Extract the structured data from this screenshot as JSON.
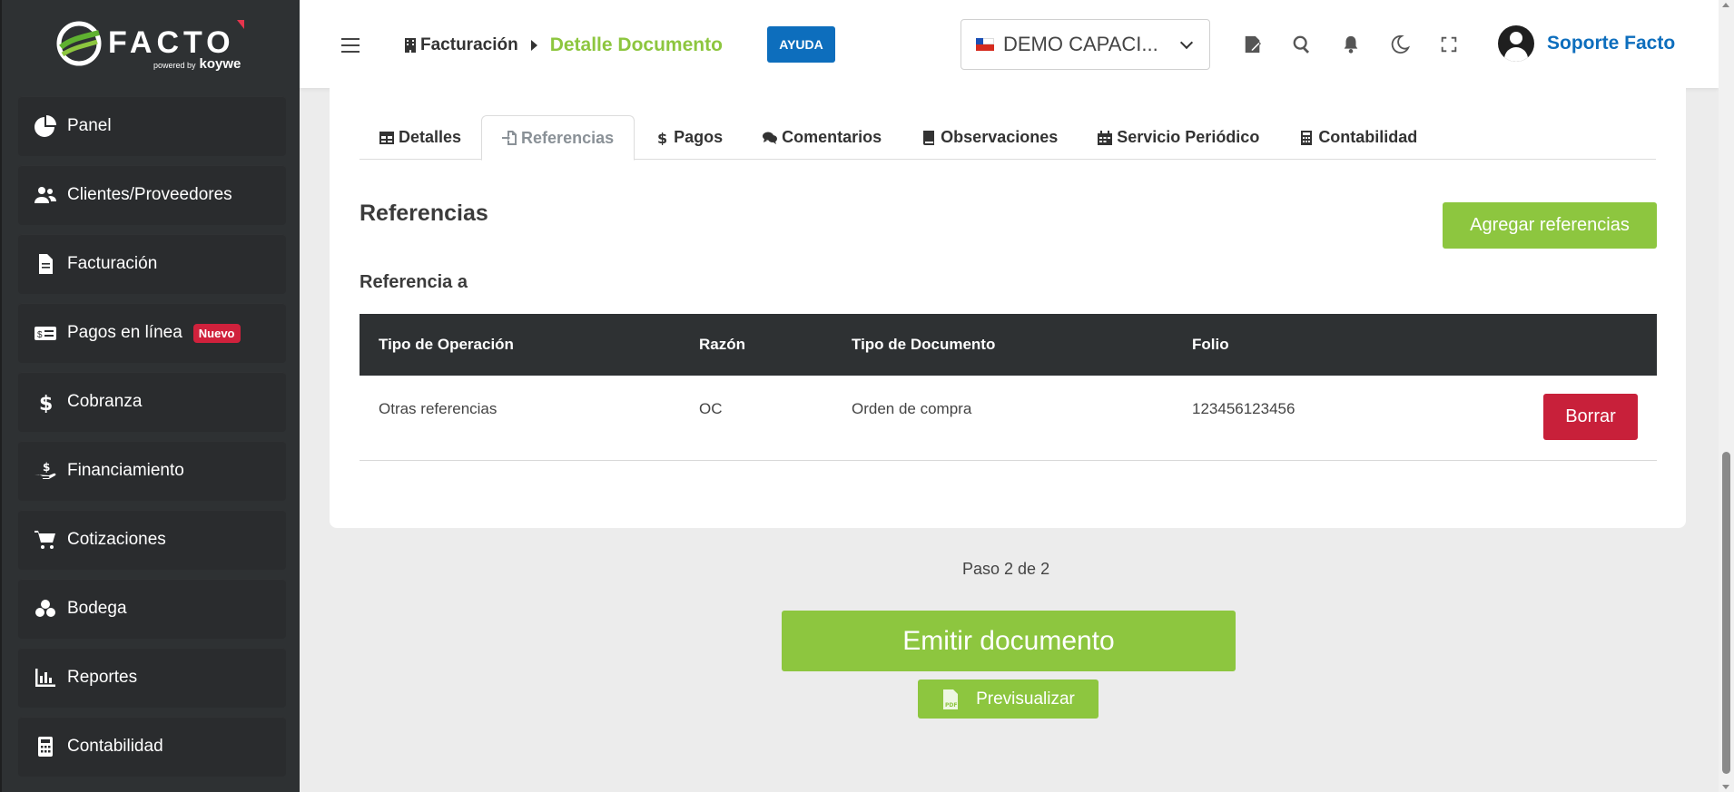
{
  "brand": {
    "name": "FACTO",
    "powered_by": "powered by",
    "partner": "koywe"
  },
  "sidebar": {
    "items": [
      {
        "label": "Panel",
        "icon": "pie-chart-icon"
      },
      {
        "label": "Clientes/Proveedores",
        "icon": "users-icon"
      },
      {
        "label": "Facturación",
        "icon": "file-icon"
      },
      {
        "label": "Pagos en línea",
        "icon": "money-bill-icon",
        "badge": "Nuevo"
      },
      {
        "label": "Cobranza",
        "icon": "dollar-icon"
      },
      {
        "label": "Financiamiento",
        "icon": "hand-money-icon"
      },
      {
        "label": "Cotizaciones",
        "icon": "cart-icon"
      },
      {
        "label": "Bodega",
        "icon": "boxes-icon"
      },
      {
        "label": "Reportes",
        "icon": "bar-chart-icon"
      },
      {
        "label": "Contabilidad",
        "icon": "calculator-icon"
      }
    ]
  },
  "header": {
    "breadcrumb_root": "Facturación",
    "breadcrumb_current": "Detalle Documento",
    "help_label": "AYUDA",
    "company": "DEMO CAPACI...",
    "user_name": "Soporte Facto"
  },
  "tabs": [
    {
      "label": "Detalles",
      "icon": "table-icon"
    },
    {
      "label": "Referencias",
      "icon": "file-import-icon",
      "active": true
    },
    {
      "label": "Pagos",
      "icon": "dollar-icon"
    },
    {
      "label": "Comentarios",
      "icon": "comments-icon"
    },
    {
      "label": "Observaciones",
      "icon": "book-icon"
    },
    {
      "label": "Servicio Periódico",
      "icon": "calendar-icon"
    },
    {
      "label": "Contabilidad",
      "icon": "calculator-icon"
    }
  ],
  "references": {
    "title": "Referencias",
    "add_button": "Agregar referencias",
    "subtitle": "Referencia a",
    "columns": [
      "Tipo de Operación",
      "Razón",
      "Tipo de Documento",
      "Folio"
    ],
    "rows": [
      {
        "tipo_operacion": "Otras referencias",
        "razon": "OC",
        "tipo_documento": "Orden de compra",
        "folio": "123456123456",
        "delete_label": "Borrar"
      }
    ]
  },
  "footer": {
    "step": "Paso 2 de 2",
    "emit_label": "Emitir documento",
    "preview_label": "Previsualizar"
  },
  "colors": {
    "accent_green": "#8dc63f",
    "brand_blue": "#0d6ebd",
    "danger": "#c8203a",
    "sidebar_bg": "#2e3133"
  }
}
